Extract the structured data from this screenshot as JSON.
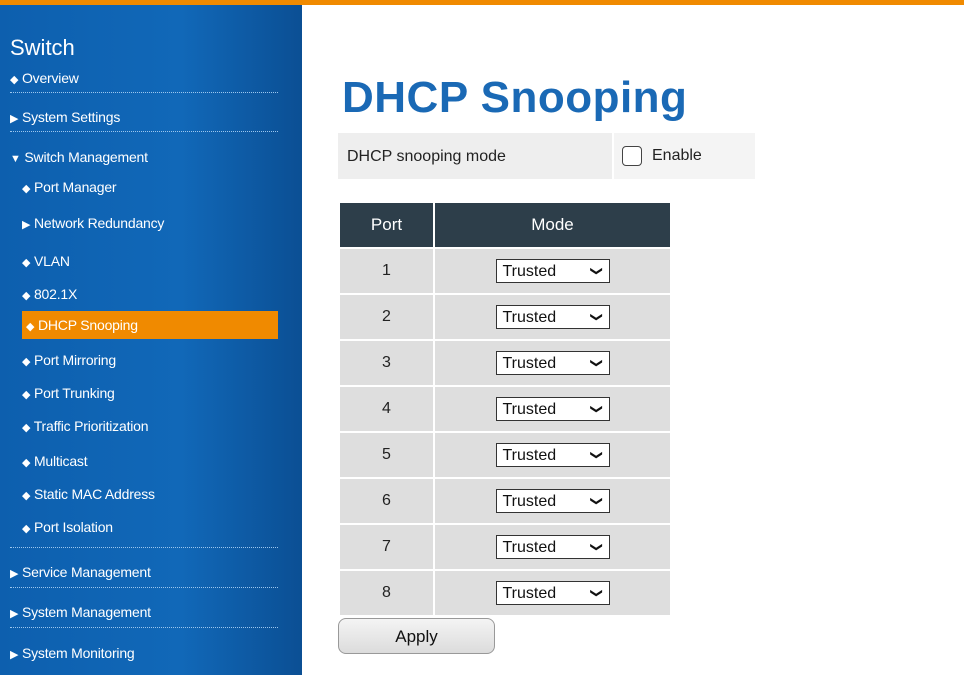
{
  "sidebar": {
    "title": "Switch",
    "items": [
      {
        "label": "Overview",
        "marker": "◆"
      },
      {
        "label": "System Settings",
        "marker": "▶"
      },
      {
        "label": "Switch Management",
        "marker": "▼"
      },
      {
        "label": "Port Manager",
        "marker": "◆"
      },
      {
        "label": "Network Redundancy",
        "marker": "▶"
      },
      {
        "label": "VLAN",
        "marker": "◆"
      },
      {
        "label": "802.1X",
        "marker": "◆"
      },
      {
        "label": "DHCP Snooping",
        "marker": "◆"
      },
      {
        "label": "Port Mirroring",
        "marker": "◆"
      },
      {
        "label": "Port Trunking",
        "marker": "◆"
      },
      {
        "label": "Traffic Prioritization",
        "marker": "◆"
      },
      {
        "label": "Multicast",
        "marker": "◆"
      },
      {
        "label": "Static MAC Address",
        "marker": "◆"
      },
      {
        "label": "Port Isolation",
        "marker": "◆"
      },
      {
        "label": "Service Management",
        "marker": "▶"
      },
      {
        "label": "System Management",
        "marker": "▶"
      },
      {
        "label": "System Monitoring",
        "marker": "▶"
      }
    ],
    "active_item": "DHCP Snooping"
  },
  "main": {
    "title": "DHCP Snooping",
    "mode_label": "DHCP snooping mode",
    "enable_label": "Enable",
    "enable_checked": false,
    "table": {
      "headers": [
        "Port",
        "Mode"
      ],
      "rows": [
        {
          "port": "1",
          "mode": "Trusted"
        },
        {
          "port": "2",
          "mode": "Trusted"
        },
        {
          "port": "3",
          "mode": "Trusted"
        },
        {
          "port": "4",
          "mode": "Trusted"
        },
        {
          "port": "5",
          "mode": "Trusted"
        },
        {
          "port": "6",
          "mode": "Trusted"
        },
        {
          "port": "7",
          "mode": "Trusted"
        },
        {
          "port": "8",
          "mode": "Trusted"
        }
      ]
    },
    "apply_label": "Apply"
  },
  "colors": {
    "accent": "#f08a00",
    "sidebar": "#1168b8",
    "title": "#1a69b5",
    "table_header": "#2d3e4a"
  }
}
